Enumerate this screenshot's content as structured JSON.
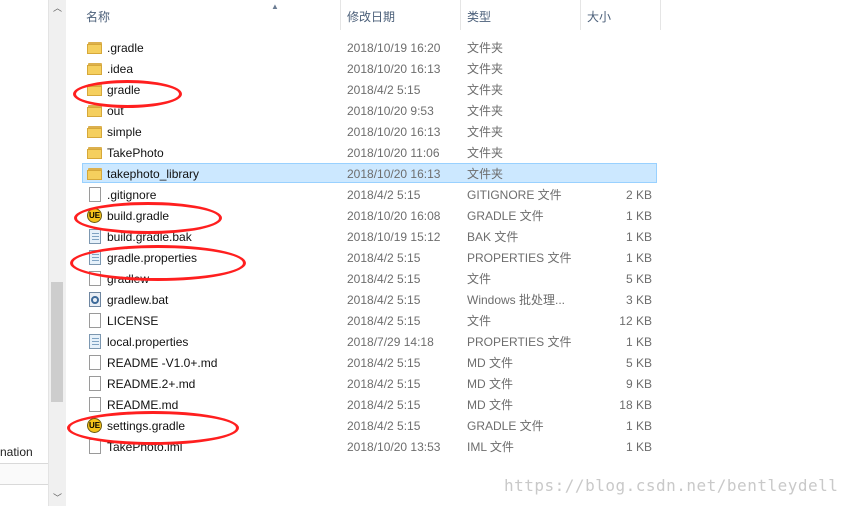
{
  "nav": {
    "partial_label": "nation"
  },
  "header": {
    "columns": {
      "name": "名称",
      "date": "修改日期",
      "type": "类型",
      "size": "大小"
    }
  },
  "files": [
    {
      "name": ".gradle",
      "date": "2018/10/19 16:20",
      "type": "文件夹",
      "size": "",
      "icon": "folder-icon"
    },
    {
      "name": ".idea",
      "date": "2018/10/20 16:13",
      "type": "文件夹",
      "size": "",
      "icon": "folder-icon"
    },
    {
      "name": "gradle",
      "date": "2018/4/2 5:15",
      "type": "文件夹",
      "size": "",
      "icon": "folder-icon"
    },
    {
      "name": "out",
      "date": "2018/10/20 9:53",
      "type": "文件夹",
      "size": "",
      "icon": "folder-icon"
    },
    {
      "name": "simple",
      "date": "2018/10/20 16:13",
      "type": "文件夹",
      "size": "",
      "icon": "folder-icon"
    },
    {
      "name": "TakePhoto",
      "date": "2018/10/20 11:06",
      "type": "文件夹",
      "size": "",
      "icon": "folder-icon"
    },
    {
      "name": "takephoto_library",
      "date": "2018/10/20 16:13",
      "type": "文件夹",
      "size": "",
      "icon": "folder-icon",
      "selected": true
    },
    {
      "name": ".gitignore",
      "date": "2018/4/2 5:15",
      "type": "GITIGNORE 文件",
      "size": "2 KB",
      "icon": "file-icon"
    },
    {
      "name": "build.gradle",
      "date": "2018/10/20 16:08",
      "type": "GRADLE 文件",
      "size": "1 KB",
      "icon": "ultraedit-icon"
    },
    {
      "name": "build.gradle.bak",
      "date": "2018/10/19 15:12",
      "type": "BAK 文件",
      "size": "1 KB",
      "icon": "config-file-icon"
    },
    {
      "name": "gradle.properties",
      "date": "2018/4/2 5:15",
      "type": "PROPERTIES 文件",
      "size": "1 KB",
      "icon": "config-file-icon"
    },
    {
      "name": "gradlew",
      "date": "2018/4/2 5:15",
      "type": "文件",
      "size": "5 KB",
      "icon": "file-icon"
    },
    {
      "name": "gradlew.bat",
      "date": "2018/4/2 5:15",
      "type": "Windows 批处理...",
      "size": "3 KB",
      "icon": "batch-file-icon"
    },
    {
      "name": "LICENSE",
      "date": "2018/4/2 5:15",
      "type": "文件",
      "size": "12 KB",
      "icon": "file-icon"
    },
    {
      "name": "local.properties",
      "date": "2018/7/29 14:18",
      "type": "PROPERTIES 文件",
      "size": "1 KB",
      "icon": "config-file-icon"
    },
    {
      "name": "README -V1.0+.md",
      "date": "2018/4/2 5:15",
      "type": "MD 文件",
      "size": "5 KB",
      "icon": "file-icon"
    },
    {
      "name": "README.2+.md",
      "date": "2018/4/2 5:15",
      "type": "MD 文件",
      "size": "9 KB",
      "icon": "file-icon"
    },
    {
      "name": "README.md",
      "date": "2018/4/2 5:15",
      "type": "MD 文件",
      "size": "18 KB",
      "icon": "file-icon"
    },
    {
      "name": "settings.gradle",
      "date": "2018/4/2 5:15",
      "type": "GRADLE 文件",
      "size": "1 KB",
      "icon": "ultraedit-icon"
    },
    {
      "name": "TakePhoto.iml",
      "date": "2018/10/20 13:53",
      "type": "IML 文件",
      "size": "1 KB",
      "icon": "file-icon"
    }
  ],
  "watermark": "https://blog.csdn.net/bentleydell",
  "colors": {
    "selection": "#cce8ff",
    "selection_border": "#99d1ff",
    "annotation": "#ff1f1f",
    "header_text": "#4c607a"
  }
}
